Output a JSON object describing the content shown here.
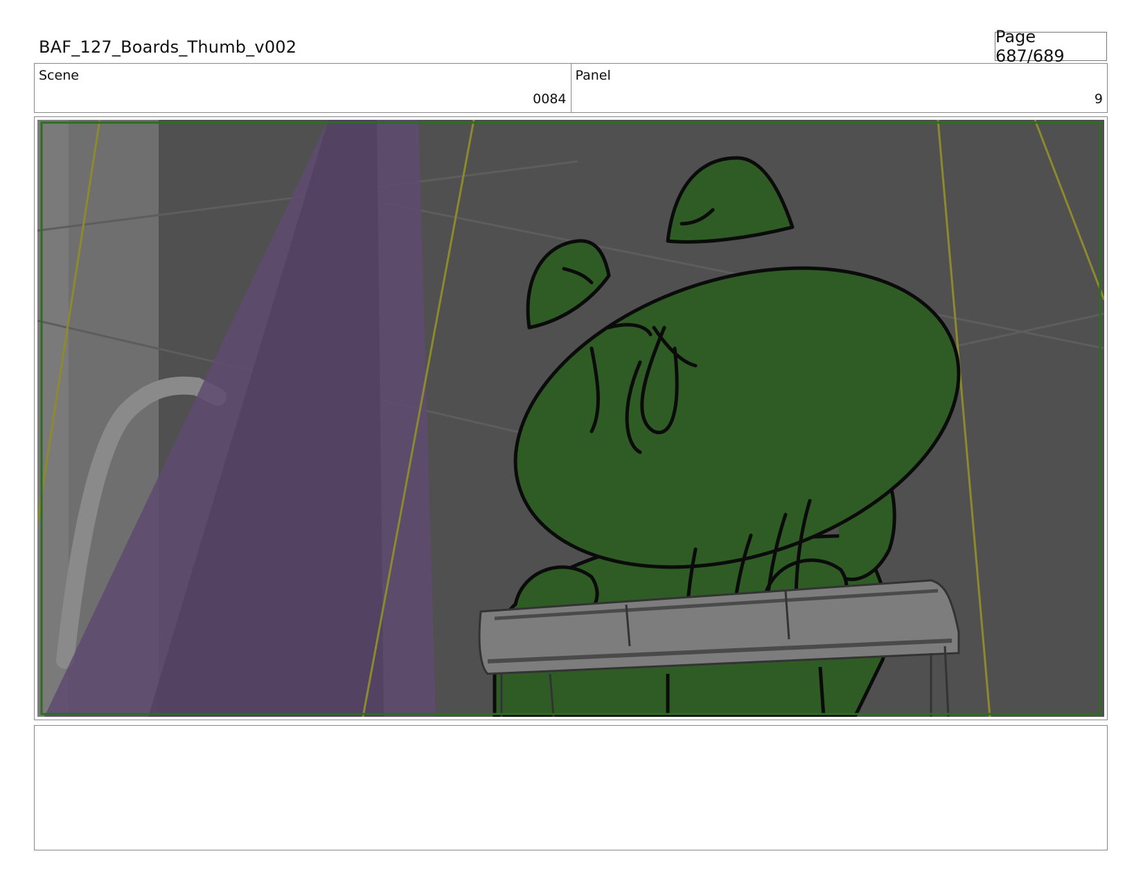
{
  "header": {
    "title": "BAF_127_Boards_Thumb_v002",
    "page_label": "Page 687/689"
  },
  "info": {
    "scene_label": "Scene",
    "scene_value": "0084",
    "panel_label": "Panel",
    "panel_value": "9"
  },
  "panel_image": {
    "background_color": "#505050",
    "safe_frame_color": "#2f6b22",
    "character_fill": "#2e5c24",
    "light_beam_color": "#5e4a70",
    "bench_color": "#7d7d7d",
    "guide_line_color": "#8c8a2c"
  },
  "notes": {
    "text": ""
  }
}
